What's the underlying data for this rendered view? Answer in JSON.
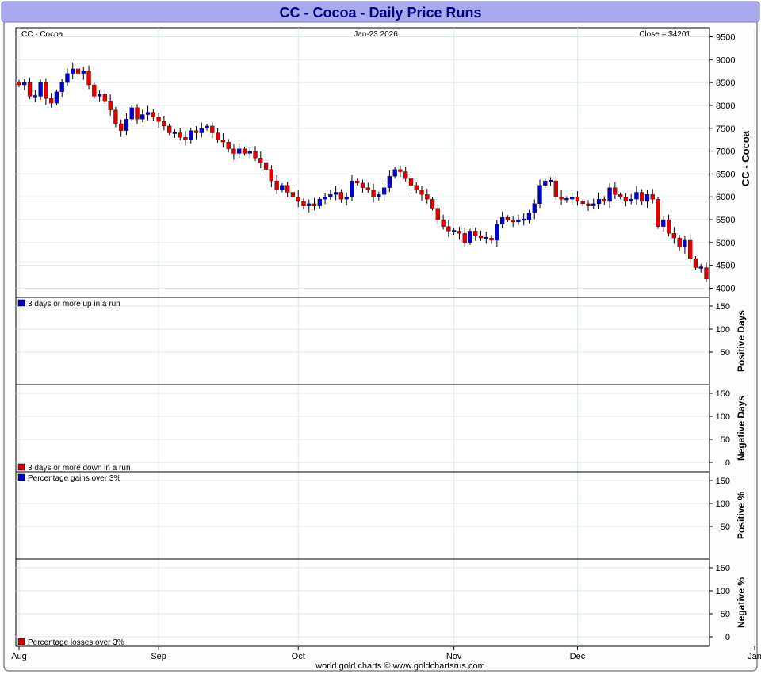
{
  "title": "CC  -  Cocoa - Daily Price Runs",
  "header": {
    "symbol": "CC  -  Cocoa",
    "date": "Jan-23  2026",
    "close": "Close = $4201"
  },
  "footer": "world gold charts © www.goldchartsrus.com",
  "colors": {
    "up": "#0000cc",
    "down": "#dd0000",
    "title_bg": "#aaaaee",
    "title_text": "#000088",
    "grid": "#dde8ee"
  },
  "chart_data": [
    {
      "type": "candlestick",
      "name": "price",
      "right_label": "CC  -  Cocoa",
      "ylim": [
        3800,
        9700
      ],
      "yticks": [
        4000,
        4500,
        5000,
        5500,
        6000,
        6500,
        7000,
        7500,
        8000,
        8500,
        9000,
        9500
      ],
      "x_months": [
        "Aug",
        "Sep",
        "Oct",
        "Nov",
        "Dec",
        "Jan"
      ],
      "month_start_index": [
        0,
        26,
        52,
        81,
        104,
        137
      ],
      "legend": "none",
      "grid": true,
      "close": [
        8450,
        8500,
        8200,
        8200,
        8500,
        8150,
        8050,
        8300,
        8500,
        8700,
        8800,
        8700,
        8750,
        8450,
        8200,
        8250,
        8100,
        7900,
        7600,
        7450,
        7700,
        7950,
        7700,
        7800,
        7850,
        7750,
        7650,
        7550,
        7400,
        7400,
        7300,
        7250,
        7450,
        7400,
        7500,
        7550,
        7400,
        7250,
        7200,
        7050,
        6950,
        7050,
        6950,
        7000,
        6850,
        6750,
        6600,
        6350,
        6150,
        6250,
        6100,
        6000,
        5900,
        5800,
        5850,
        5800,
        5950,
        6000,
        6050,
        6100,
        5950,
        6000,
        6350,
        6300,
        6200,
        6150,
        6000,
        6050,
        6200,
        6450,
        6600,
        6550,
        6400,
        6250,
        6150,
        6050,
        5950,
        5750,
        5500,
        5350,
        5250,
        5250,
        5200,
        5000,
        5250,
        5150,
        5100,
        5100,
        5050,
        5400,
        5550,
        5500,
        5450,
        5500,
        5500,
        5650,
        5850,
        6250,
        6350,
        6350,
        6000,
        5950,
        5950,
        6000,
        5900,
        5850,
        5800,
        5850,
        5950,
        5900,
        6200,
        6050,
        6000,
        5900,
        5950,
        6100,
        5900,
        6050,
        5950,
        5350,
        5500,
        5200,
        5100,
        4900,
        5050,
        4650,
        4450,
        4450,
        4201
      ]
    },
    {
      "type": "bar",
      "name": "positive-days",
      "label": "3 days or more up in a run",
      "right_label": "Positive Days",
      "ylim": [
        0,
        150
      ],
      "yticks": [
        50,
        100,
        150
      ],
      "values": []
    },
    {
      "type": "bar",
      "name": "negative-days",
      "label": "3 days or more down in a run",
      "right_label": "Negative Days",
      "ylim": [
        0,
        150
      ],
      "yticks": [
        0,
        50,
        100,
        150
      ],
      "values": []
    },
    {
      "type": "bar",
      "name": "positive-percent",
      "label": "Percentage gains over 3%",
      "right_label": "Positive %",
      "ylim": [
        0,
        150
      ],
      "yticks": [
        50,
        100,
        150
      ],
      "values": []
    },
    {
      "type": "bar",
      "name": "negative-percent",
      "label": "Percentage losses over 3%",
      "right_label": "Negative %",
      "ylim": [
        0,
        150
      ],
      "yticks": [
        0,
        50,
        100,
        150
      ],
      "values": []
    }
  ]
}
